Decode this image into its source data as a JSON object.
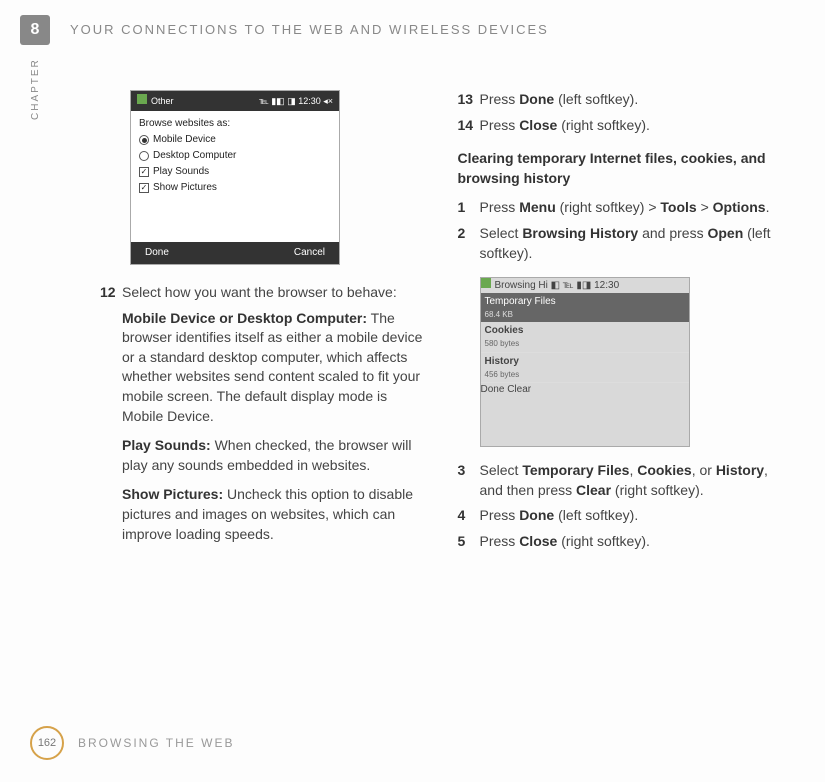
{
  "chapter_number": "8",
  "chapter_label": "CHAPTER",
  "header_title": "YOUR CONNECTIONS TO THE WEB AND WIRELESS DEVICES",
  "page_number": "162",
  "footer_text": "BROWSING THE WEB",
  "shot1": {
    "title_left": "Other",
    "title_right": "℡ ▮◧ ◨ 12:30  ◂×",
    "prompt": "Browse websites as:",
    "radio1": "Mobile Device",
    "radio2": "Desktop Computer",
    "check1": "Play Sounds",
    "check2": "Show Pictures",
    "sk_left": "Done",
    "sk_right": "Cancel"
  },
  "shot2": {
    "title_left": "Browsing Hi",
    "title_right": "◧ ℡ ▮◨ 12:30",
    "row1_label": "Temporary Files",
    "row1_size": "68.4 KB",
    "row2_label": "Cookies",
    "row2_size": "580 bytes",
    "row3_label": "History",
    "row3_size": "456 bytes",
    "sk_left": "Done",
    "sk_right": "Clear"
  },
  "left": {
    "s12_num": "12",
    "s12_text": "Select how you want the browser to behave:",
    "opt1_label": "Mobile Device or Desktop Computer:",
    "opt1_text": " The browser identifies itself as either a mobile device or a standard desktop computer, which affects whether websites send content scaled to fit your mobile screen. The default display mode is Mobile Device.",
    "opt2_label": "Play Sounds:",
    "opt2_text": " When checked, the browser will play any sounds embedded in websites.",
    "opt3_label": "Show Pictures:",
    "opt3_text": " Uncheck this option to disable pictures and images on websites, which can improve loading speeds."
  },
  "right": {
    "s13_num": "13",
    "s13_a": "Press ",
    "s13_b": "Done",
    "s13_c": " (left softkey).",
    "s14_num": "14",
    "s14_a": "Press ",
    "s14_b": "Close",
    "s14_c": " (right softkey).",
    "heading": "Clearing temporary Internet files, cookies, and browsing history",
    "s1_num": "1",
    "s1_a": "Press ",
    "s1_b": "Menu",
    "s1_c": " (right softkey) > ",
    "s1_d": "Tools",
    "s1_e": " > ",
    "s1_f": "Options",
    "s1_g": ".",
    "s2_num": "2",
    "s2_a": "Select ",
    "s2_b": "Browsing History",
    "s2_c": " and press ",
    "s2_d": "Open",
    "s2_e": " (left softkey).",
    "s3_num": "3",
    "s3_a": "Select ",
    "s3_b": "Temporary Files",
    "s3_c": ", ",
    "s3_d": "Cookies",
    "s3_e": ", or ",
    "s3_f": "History",
    "s3_g": ", and then press ",
    "s3_h": "Clear",
    "s3_i": " (right softkey).",
    "s4_num": "4",
    "s4_a": "Press ",
    "s4_b": "Done",
    "s4_c": " (left softkey).",
    "s5_num": "5",
    "s5_a": "Press ",
    "s5_b": "Close",
    "s5_c": " (right softkey)."
  }
}
